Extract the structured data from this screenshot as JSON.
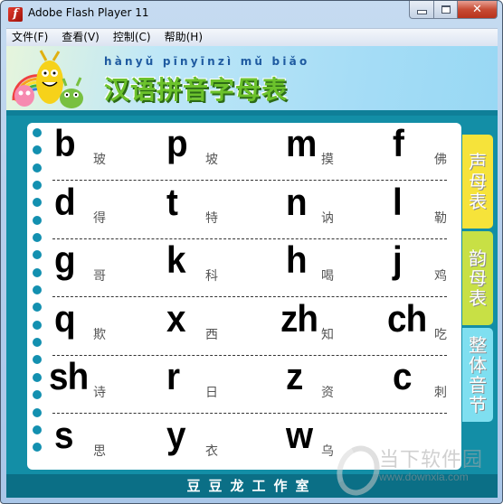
{
  "window": {
    "title": "Adobe Flash Player 11",
    "app_icon_glyph": "f",
    "controls": {
      "minimize": "minimize",
      "maximize": "maximize",
      "close": "✕"
    }
  },
  "menubar": {
    "items": [
      {
        "label": "文件(F)"
      },
      {
        "label": "查看(V)"
      },
      {
        "label": "控制(C)"
      },
      {
        "label": "帮助(H)"
      }
    ]
  },
  "banner": {
    "pinyin": "hànyǔ pīnyīnzì mǔ biǎo",
    "title": "汉语拼音字母表"
  },
  "initials": {
    "rows": [
      [
        {
          "letter": "b",
          "hanzi": "玻"
        },
        {
          "letter": "p",
          "hanzi": "坡"
        },
        {
          "letter": "m",
          "hanzi": "摸"
        },
        {
          "letter": "f",
          "hanzi": "佛"
        }
      ],
      [
        {
          "letter": "d",
          "hanzi": "得"
        },
        {
          "letter": "t",
          "hanzi": "特"
        },
        {
          "letter": "n",
          "hanzi": "讷"
        },
        {
          "letter": "l",
          "hanzi": "勒"
        }
      ],
      [
        {
          "letter": "g",
          "hanzi": "哥"
        },
        {
          "letter": "k",
          "hanzi": "科"
        },
        {
          "letter": "h",
          "hanzi": "喝"
        },
        {
          "letter": "j",
          "hanzi": "鸡"
        }
      ],
      [
        {
          "letter": "q",
          "hanzi": "欺"
        },
        {
          "letter": "x",
          "hanzi": "西"
        },
        {
          "letter": "zh",
          "hanzi": "知"
        },
        {
          "letter": "ch",
          "hanzi": "吃"
        }
      ],
      [
        {
          "letter": "sh",
          "hanzi": "诗"
        },
        {
          "letter": "r",
          "hanzi": "日"
        },
        {
          "letter": "z",
          "hanzi": "资"
        },
        {
          "letter": "c",
          "hanzi": "刺"
        }
      ],
      [
        {
          "letter": "s",
          "hanzi": "思"
        },
        {
          "letter": "y",
          "hanzi": "衣"
        },
        {
          "letter": "w",
          "hanzi": "乌"
        }
      ]
    ]
  },
  "side_tabs": [
    {
      "label": "声母表",
      "chars": [
        "声",
        "母",
        "表"
      ],
      "color": "#f6e33a",
      "active": true
    },
    {
      "label": "韵母表",
      "chars": [
        "韵",
        "母",
        "表"
      ],
      "color": "#c8e045",
      "active": false
    },
    {
      "label": "整体音节",
      "chars": [
        "整",
        "体",
        "音",
        "节"
      ],
      "color": "#7fdff0",
      "active": false
    }
  ],
  "footer": {
    "text": "豆豆龙工作室"
  },
  "watermark": {
    "name": "当下软件园",
    "url": "www.downxia.com"
  },
  "colors": {
    "content_bg": "#138ea6",
    "footer_bg": "#0b6f86",
    "hole": "#1390b0",
    "title_green": "#6cc22c"
  }
}
